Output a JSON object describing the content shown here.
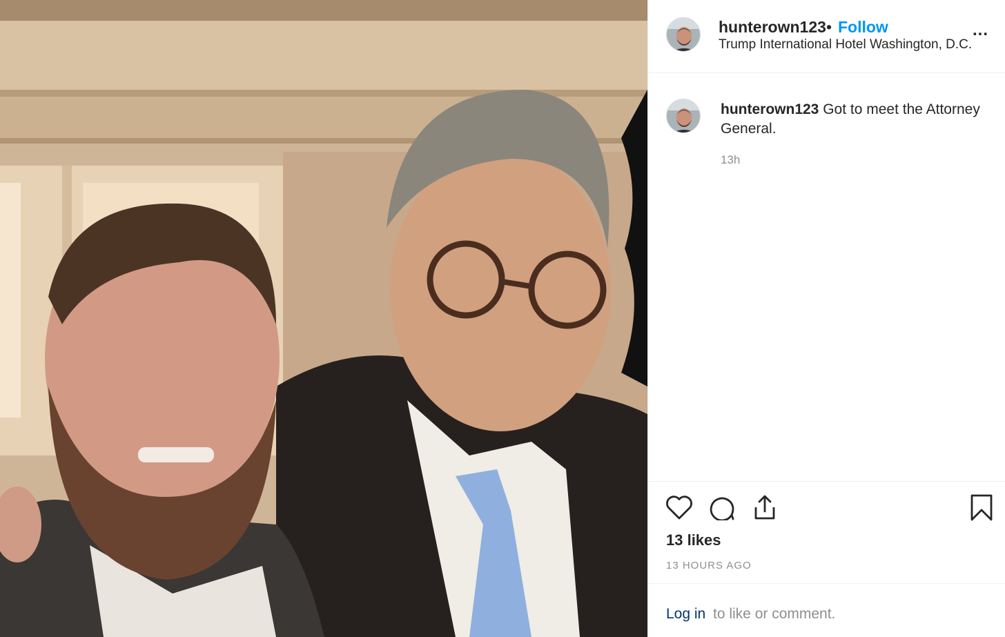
{
  "post": {
    "photo_alt": "photo",
    "username": "hunterown123",
    "separator": "•",
    "follow_label": "Follow",
    "location": "Trump International Hotel Washington, D.C.",
    "more_label": "...",
    "caption_user": "hunterown123",
    "caption_text": "Got to meet the Attorney General.",
    "caption_time": "13h",
    "likes": "13 likes",
    "posted_ago": "13 HOURS AGO",
    "login_link": "Log in",
    "login_rest": "to like or comment."
  },
  "icons": {
    "like": "heart-icon",
    "comment": "comment-bubble-icon",
    "share": "share-icon",
    "save": "bookmark-icon",
    "more": "ellipsis-icon"
  },
  "colors": {
    "follow": "#0095f6",
    "link": "#00376b",
    "muted": "#8e8e8e",
    "text": "#262626"
  }
}
